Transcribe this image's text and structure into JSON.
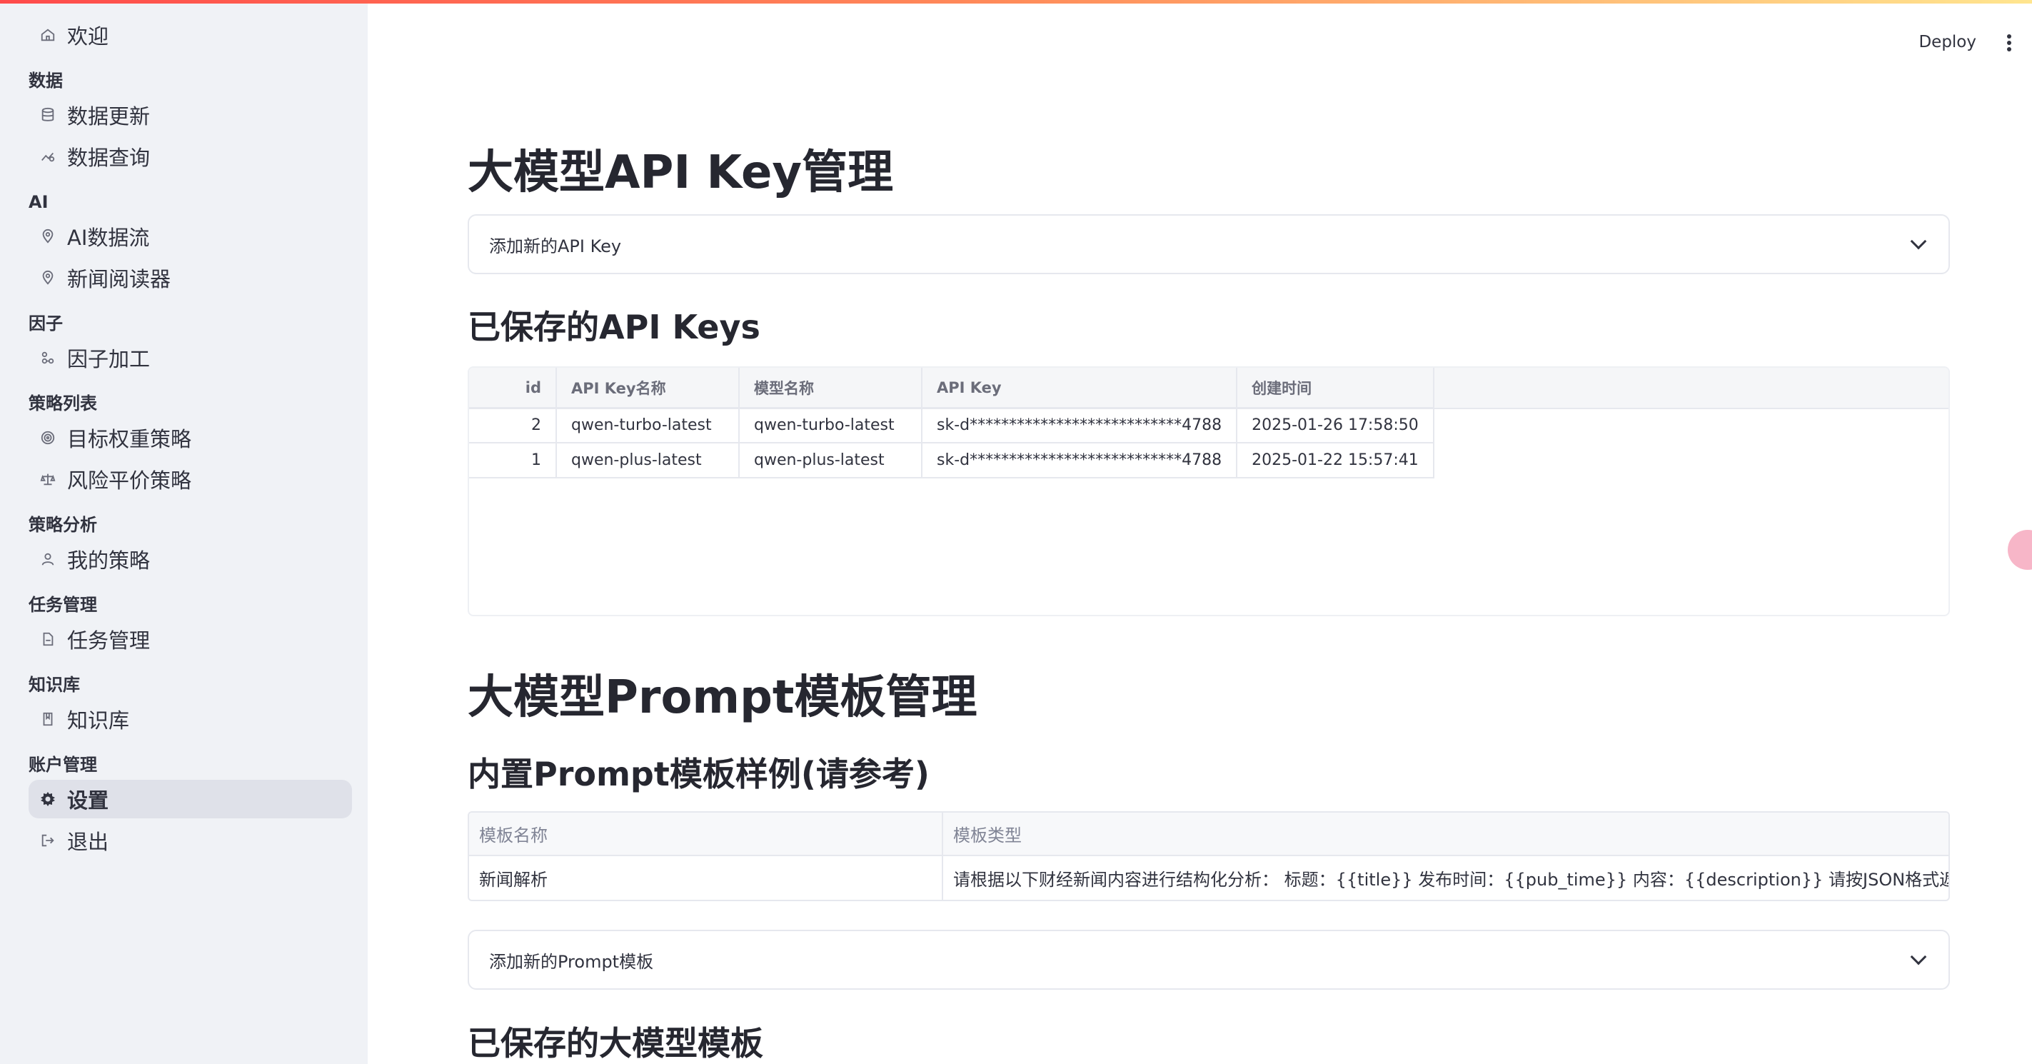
{
  "sidebar": {
    "welcome": "欢迎",
    "sections": [
      {
        "label": "数据",
        "items": [
          "数据更新",
          "数据查询"
        ]
      },
      {
        "label": "AI",
        "items": [
          "AI数据流",
          "新闻阅读器"
        ]
      },
      {
        "label": "因子",
        "items": [
          "因子加工"
        ]
      },
      {
        "label": "策略列表",
        "items": [
          "目标权重策略",
          "风险平价策略"
        ]
      },
      {
        "label": "策略分析",
        "items": [
          "我的策略"
        ]
      },
      {
        "label": "任务管理",
        "items": [
          "任务管理"
        ]
      },
      {
        "label": "知识库",
        "items": [
          "知识库"
        ]
      },
      {
        "label": "账户管理",
        "items": [
          "设置",
          "退出"
        ]
      }
    ]
  },
  "header": {
    "deploy_label": "Deploy"
  },
  "api": {
    "title": "大模型API Key管理",
    "add_expander": "添加新的API Key",
    "saved_title": "已保存的API Keys",
    "columns": [
      "id",
      "API Key名称",
      "模型名称",
      "API Key",
      "创建时间"
    ],
    "rows": [
      [
        "2",
        "qwen-turbo-latest",
        "qwen-turbo-latest",
        "sk-d***************************4788",
        "2025-01-26 17:58:50"
      ],
      [
        "1",
        "qwen-plus-latest",
        "qwen-plus-latest",
        "sk-d***************************4788",
        "2025-01-22 15:57:41"
      ]
    ]
  },
  "prompt": {
    "title": "大模型Prompt模板管理",
    "builtin_title": "内置Prompt模板样例(请参考)",
    "columns": [
      "模板名称",
      "模板类型"
    ],
    "rows": [
      [
        "新闻解析",
        "请根据以下财经新闻内容进行结构化分析： 标题：{{title}} 发布时间：{{pub_time}} 内容：{{description}}  请按JSON格式返回：  {{  \"co"
      ]
    ],
    "add_expander": "添加新的Prompt模板",
    "saved_title": "已保存的大模型模板"
  }
}
